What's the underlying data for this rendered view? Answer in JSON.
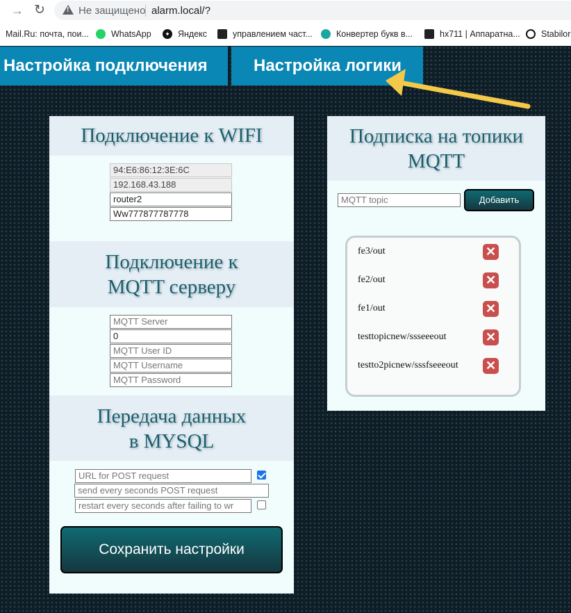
{
  "browser": {
    "security_label": "Не защищено",
    "url": "alarm.local/?",
    "bookmarks": [
      {
        "label": "Mail.Ru: почта, пои...",
        "icon": "mailru-icon"
      },
      {
        "label": "WhatsApp",
        "icon": "whatsapp-icon"
      },
      {
        "label": "Яндекс",
        "icon": "yandex-icon"
      },
      {
        "label": "управлением част...",
        "icon": "site-icon"
      },
      {
        "label": "Конвертер букв в...",
        "icon": "converter-icon"
      },
      {
        "label": "hx711 | Аппаратна...",
        "icon": "site-icon"
      },
      {
        "label": "Stabilor",
        "icon": "arduino-icon"
      }
    ]
  },
  "tabs": {
    "connection": "Настройка подключения",
    "logic": "Настройка логики"
  },
  "wifi": {
    "title": "Подключение к WIFI",
    "mac": "94:E6:86:12:3E:6C",
    "ip": "192.168.43.188",
    "ssid": "router2",
    "password": "Ww777877787778"
  },
  "mqtt": {
    "title_line1": "Подключение к",
    "title_line2": "MQTT серверу",
    "server_placeholder": "MQTT Server",
    "port": "0",
    "user_id_placeholder": "MQTT User ID",
    "username_placeholder": "MQTT Username",
    "password_placeholder": "MQTT Password"
  },
  "mysql": {
    "title_line1": "Передача данных",
    "title_line2": "в MYSQL",
    "url_placeholder": "URL for POST request",
    "url_enabled": true,
    "interval_placeholder": "send every seconds POST request",
    "restart_placeholder": "restart every seconds after failing to wr",
    "restart_enabled": false
  },
  "save_label": "Сохранить настройки",
  "subscriptions": {
    "title_line1": "Подписка на топики",
    "title_line2": "MQTT",
    "topic_placeholder": "MQTT topic",
    "add_label": "Добавить",
    "topics": [
      "fe3/out",
      "fe2/out",
      "fe1/out",
      "testtopicnew/ssseeeout",
      "testto2picnew/sssfseeeout"
    ]
  },
  "colors": {
    "tab_bg": "#0a87b4",
    "heading": "#1a5e6e",
    "button_top": "#0f6a72",
    "button_bottom": "#16373f",
    "delete": "#c94f4f",
    "arrow": "#f4c94a"
  }
}
